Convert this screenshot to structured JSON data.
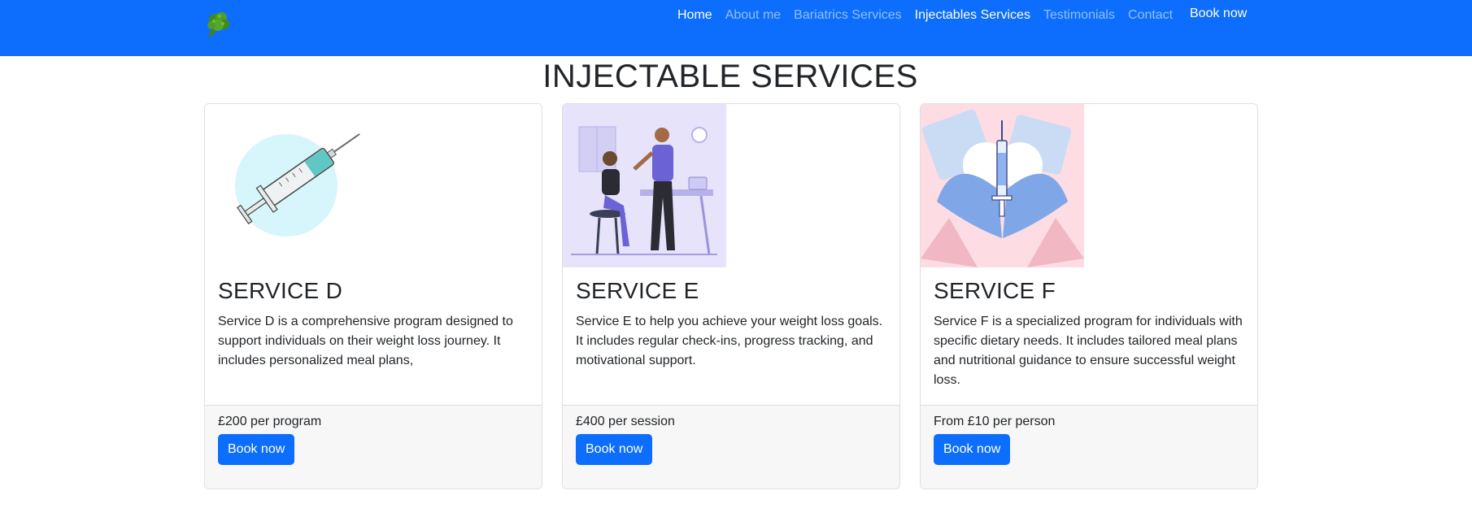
{
  "nav": {
    "brand_icon": "broccoli-icon",
    "links": [
      {
        "label": "Home"
      },
      {
        "label": "About me"
      },
      {
        "label": "Bariatrics Services"
      },
      {
        "label": "Injectables Services"
      },
      {
        "label": "Testimonials"
      },
      {
        "label": "Contact"
      }
    ],
    "book_label": "Book now",
    "colors": {
      "bar": "#0d6efd",
      "active": "#ffffff",
      "muted": "rgba(255,255,255,0.55)"
    }
  },
  "page_title": "INJECTABLE SERVICES",
  "cards": [
    {
      "image": "syringe-illustration",
      "title": "SERVICE D",
      "text": "Service D is a comprehensive program designed to support individuals on their weight loss journey. It includes personalized meal plans,",
      "price": "£200 per program",
      "button": "Book now"
    },
    {
      "image": "vaccination-illustration",
      "title": "SERVICE E",
      "text": "Service E to help you achieve your weight loss goals. It includes regular check-ins, progress tracking, and motivational support.",
      "price": "£400 per session",
      "button": "Book now"
    },
    {
      "image": "heart-hands-syringe-illustration",
      "title": "SERVICE F",
      "text": "Service F is a specialized program for individuals with specific dietary needs. It includes tailored meal plans and nutritional guidance to ensure successful weight loss.",
      "price": "From £10 per person",
      "button": "Book now"
    }
  ],
  "colors": {
    "primary": "#0d6efd",
    "footer_bg": "#f7f7f7",
    "border": "#dfdfdf"
  }
}
